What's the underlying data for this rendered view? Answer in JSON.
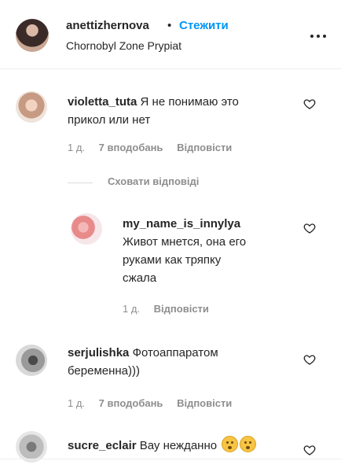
{
  "header": {
    "username": "anettizhernova",
    "separator": "•",
    "follow_label": "Стежити",
    "location": "Chornobyl Zone Prypiat"
  },
  "comments": [
    {
      "username": "violetta_tuta",
      "text": "Я не понимаю это прикол или нет",
      "line1": "Я не понимаю это",
      "line2": "прикол или нет",
      "time": "1 д.",
      "likes": "7 вподобань",
      "reply_label": "Відповісти"
    },
    {
      "username": "serjulishka",
      "text": "Фотоаппаратом беременна)))",
      "line1": "Фотоаппаратом",
      "line2": "беременна)))",
      "time": "1 д.",
      "likes": "7 вподобань",
      "reply_label": "Відповісти"
    },
    {
      "username": "sucre_eclair",
      "text": "Вау нежданно"
    }
  ],
  "replies_toggle": "Сховати відповіді",
  "reply": {
    "username": "my_name_is_innylya",
    "line1": "Живот мнется, она его",
    "line2": "руками как тряпку",
    "line3": "сжала",
    "time": "1 д.",
    "reply_label": "Відповісти"
  },
  "icons": {
    "more": "more-horizontal-icon",
    "like": "heart-outline-icon",
    "emoji": "flushed-face-emoji"
  }
}
